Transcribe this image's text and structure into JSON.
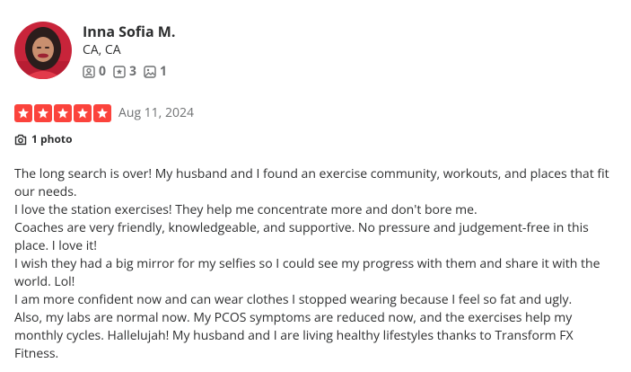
{
  "user": {
    "name": "Inna Sofia M.",
    "location": "CA, CA",
    "stats": {
      "friends": "0",
      "reviews": "3",
      "photos": "1"
    },
    "avatar_icon": "user-avatar-photo"
  },
  "review": {
    "rating": 5,
    "rating_max": 5,
    "star_color": "#fb433c",
    "date": "Aug 11, 2024",
    "photo_link_label": "1 photo",
    "paragraphs": [
      "The long search is over! My husband and I found an exercise community, workouts, and places that fit our needs.",
      "I love the station exercises! They help me concentrate more and don't bore me.",
      "Coaches are very friendly, knowledgeable, and supportive. No pressure and judgement-free in this place. I love it!",
      "I wish they had a big mirror for my selfies so I could see my progress with them and share it with the world. Lol!",
      "I am more confident now and can wear clothes I stopped wearing because I feel so fat and ugly.",
      "Also, my labs are normal now. My PCOS symptoms are reduced now, and the exercises help my monthly cycles. Hallelujah! My husband and I are living healthy lifestyles thanks to Transform FX Fitness."
    ]
  }
}
